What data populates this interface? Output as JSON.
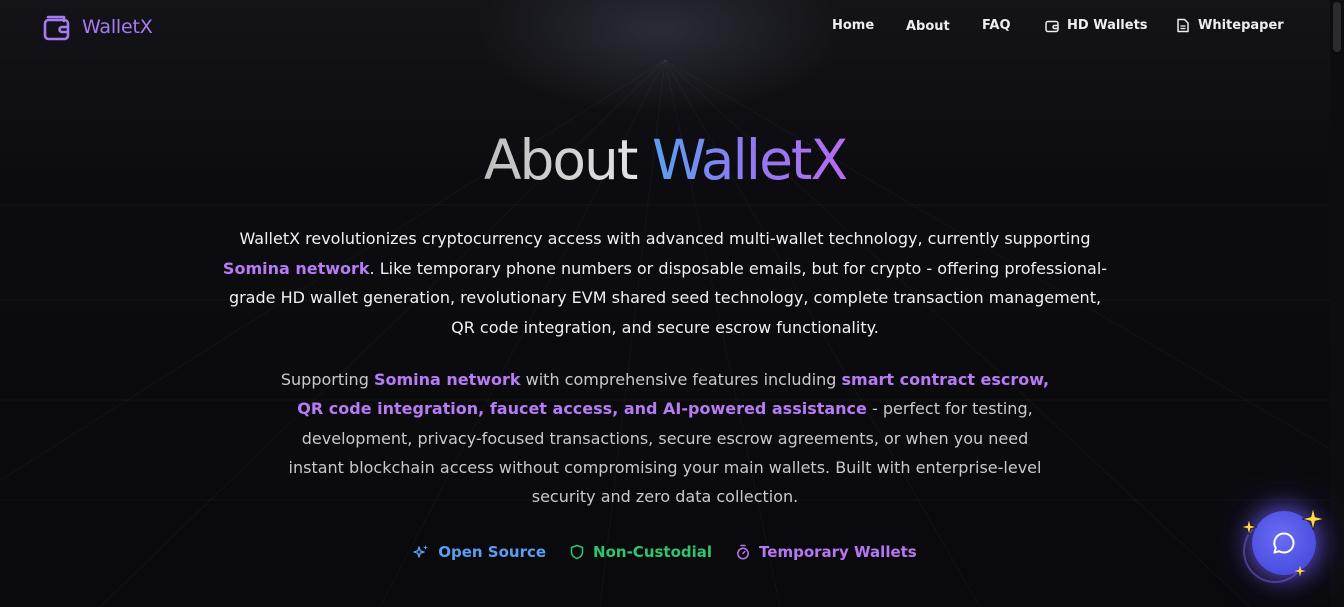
{
  "brand": {
    "name": "WalletX",
    "color": "#a77bf2"
  },
  "nav": {
    "home": "Home",
    "about": "About",
    "faq": "FAQ",
    "hd_wallets": "HD Wallets",
    "whitepaper": "Whitepaper"
  },
  "hero": {
    "title_part1": "About ",
    "title_part2": "WalletX",
    "para1": {
      "before": "WalletX revolutionizes cryptocurrency access with advanced multi-wallet technology, currently supporting ",
      "highlight": "Somina network",
      "after": ". Like temporary phone numbers or disposable emails, but for crypto - offering professional-grade HD wallet generation, revolutionary EVM shared seed technology, complete transaction management, QR code integration, and secure escrow functionality."
    },
    "para2": {
      "before": "Supporting ",
      "highlight1": "Somina network",
      "middle": " with comprehensive features including ",
      "highlight2": "smart contract escrow, QR code integration, faucet access, and AI-powered assistance",
      "after": " - perfect for testing, development, privacy-focused transactions, secure escrow agreements, or when you need instant blockchain access without compromising your main wallets. Built with enterprise-level security and zero data collection."
    }
  },
  "features": [
    {
      "label": "Open Source",
      "icon": "sparkles-icon",
      "color": "#5b9df0"
    },
    {
      "label": "Non-Custodial",
      "icon": "shield-icon",
      "color": "#2fc46e"
    },
    {
      "label": "Temporary Wallets",
      "icon": "timer-icon",
      "color": "#b777f3"
    }
  ],
  "chat": {
    "icon": "chat-bubble-icon"
  }
}
